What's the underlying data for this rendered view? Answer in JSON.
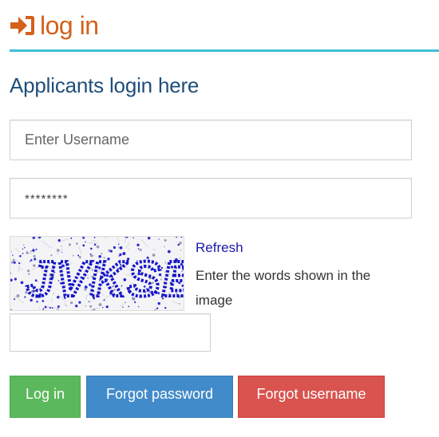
{
  "header": {
    "icon": "sign-in-icon",
    "title": "log in"
  },
  "subtitle": "Applicants login here",
  "form": {
    "username_placeholder": "Enter Username",
    "password_placeholder": "********",
    "captcha": {
      "text": "JVKSB",
      "refresh_label": "Refresh",
      "instruction": "Enter the words shown in the image",
      "input_value": ""
    }
  },
  "buttons": {
    "login": "Log in",
    "forgot_password": "Forgot password",
    "forgot_username": "Forgot username"
  },
  "colors": {
    "title": "#d4601a",
    "rule": "#3ec0d3",
    "subtitle": "#1f4e7a",
    "login": "#5cb85c",
    "forgot_password": "#428bca",
    "forgot_username": "#d9534f",
    "link": "#1a1aa6",
    "captcha_text": "#1515c8"
  }
}
